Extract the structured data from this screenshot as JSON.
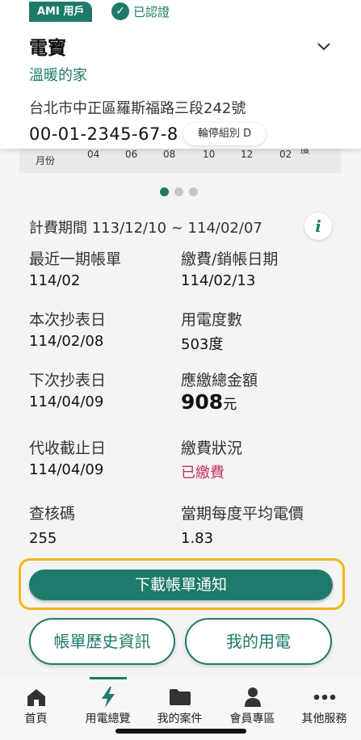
{
  "header": {
    "ami_badge": "AMI 用戶",
    "verified_label": "已認證",
    "account_name": "電寶",
    "place_name": "溫暖的家",
    "address": "台北市中正區羅斯福路三段242號",
    "account_number": "00-01-2345-67-8",
    "outage_group": "輪停組別 D"
  },
  "chart_strip": {
    "month_label": "月份",
    "ticks": [
      "04",
      "06",
      "08",
      "10",
      "12",
      "02"
    ],
    "unit": "度"
  },
  "carousel": {
    "count": 3,
    "active": 0
  },
  "billing": {
    "period_label": "計費期間",
    "period_value": "113/12/10 ~ 114/02/07",
    "info_label": "i",
    "items": [
      {
        "label": "最近一期帳單",
        "value": "114/02"
      },
      {
        "label": "繳費/銷帳日期",
        "value": "114/02/13"
      },
      {
        "label": "本次抄表日",
        "value": "114/02/08"
      },
      {
        "label": "用電度數",
        "value": "503度"
      },
      {
        "label": "下次抄表日",
        "value": "114/04/09"
      },
      {
        "label": "應繳總金額",
        "value": "908",
        "unit": "元"
      },
      {
        "label": "代收截止日",
        "value": "114/04/09"
      },
      {
        "label": "繳費狀況",
        "value": "已繳費"
      },
      {
        "label": "查核碼",
        "value": "255"
      },
      {
        "label": "當期每度平均電價",
        "value": "1.83"
      }
    ]
  },
  "actions": {
    "download": "下載帳單通知",
    "history": "帳單歷史資訊",
    "my_usage": "我的用電"
  },
  "nav": {
    "items": [
      {
        "label": "首頁",
        "icon": "home-icon"
      },
      {
        "label": "用電總覽",
        "icon": "lightning-icon"
      },
      {
        "label": "我的案件",
        "icon": "folder-icon"
      },
      {
        "label": "會員專區",
        "icon": "person-icon"
      },
      {
        "label": "其他服務",
        "icon": "more-icon"
      }
    ],
    "active": 1
  },
  "colors": {
    "accent": "#1e7a6a",
    "highlight": "#f3b51d",
    "paid": "#c0345c"
  }
}
